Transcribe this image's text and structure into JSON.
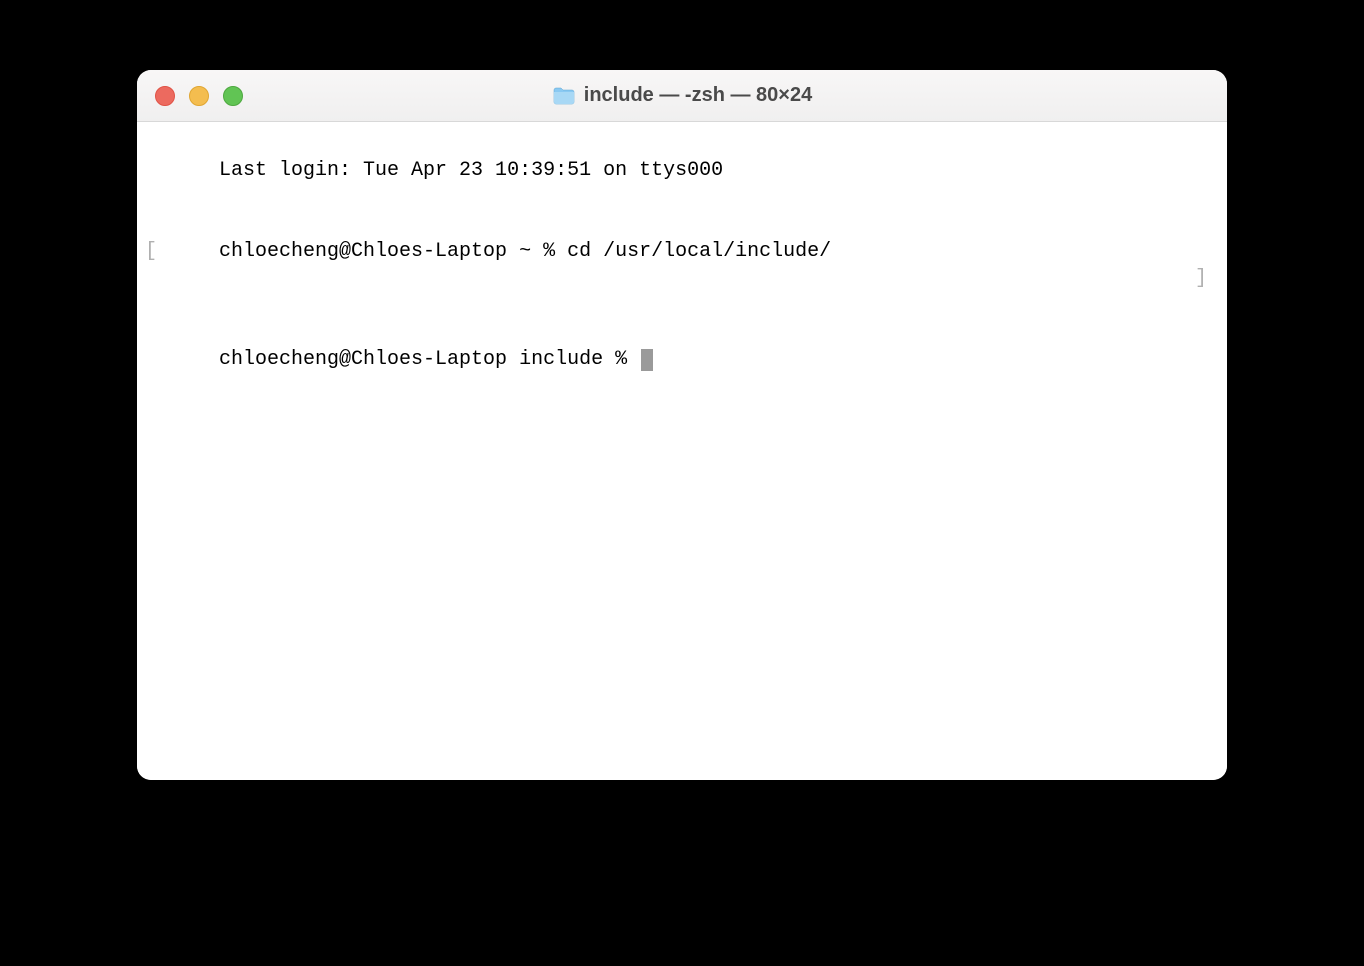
{
  "window": {
    "title": "include — -zsh — 80×24"
  },
  "terminal": {
    "line1": "Last login: Tue Apr 23 10:39:51 on ttys000",
    "line2_prompt": "chloecheng@Chloes-Laptop ~ % ",
    "line2_command": "cd /usr/local/include/",
    "line3_prompt": "chloecheng@Chloes-Laptop include % ",
    "bracket_left": "[",
    "bracket_right": "]"
  }
}
